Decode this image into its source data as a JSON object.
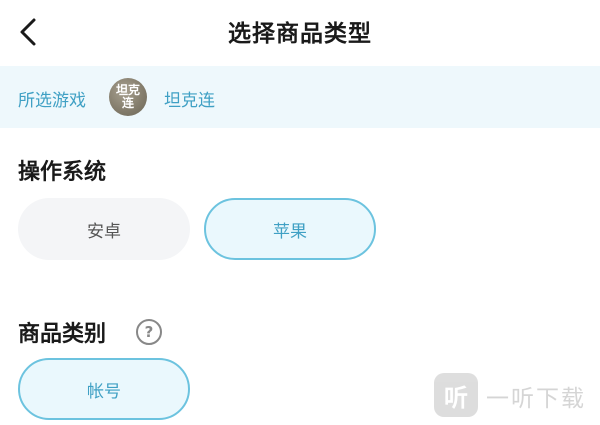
{
  "header": {
    "title": "选择商品类型",
    "back_icon": "chevron-left-icon"
  },
  "game_strip": {
    "label": "所选游戏",
    "avatar_text": "坦克连",
    "game_name": "坦克连"
  },
  "os_section": {
    "title": "操作系统",
    "options": [
      {
        "label": "安卓",
        "selected": false
      },
      {
        "label": "苹果",
        "selected": true
      }
    ]
  },
  "category_section": {
    "title": "商品类别",
    "help_icon": "question-circle-icon",
    "help_glyph": "?",
    "options": [
      {
        "label": "帐号",
        "selected": true
      }
    ]
  },
  "watermark": {
    "logo_text": "听",
    "text": "一听下载"
  },
  "colors": {
    "accent": "#3fa0c4",
    "accent_border": "#6cc3df",
    "selected_bg": "#eaf8fd",
    "strip_bg": "#eef8fc",
    "chip_bg": "#f4f5f7"
  }
}
